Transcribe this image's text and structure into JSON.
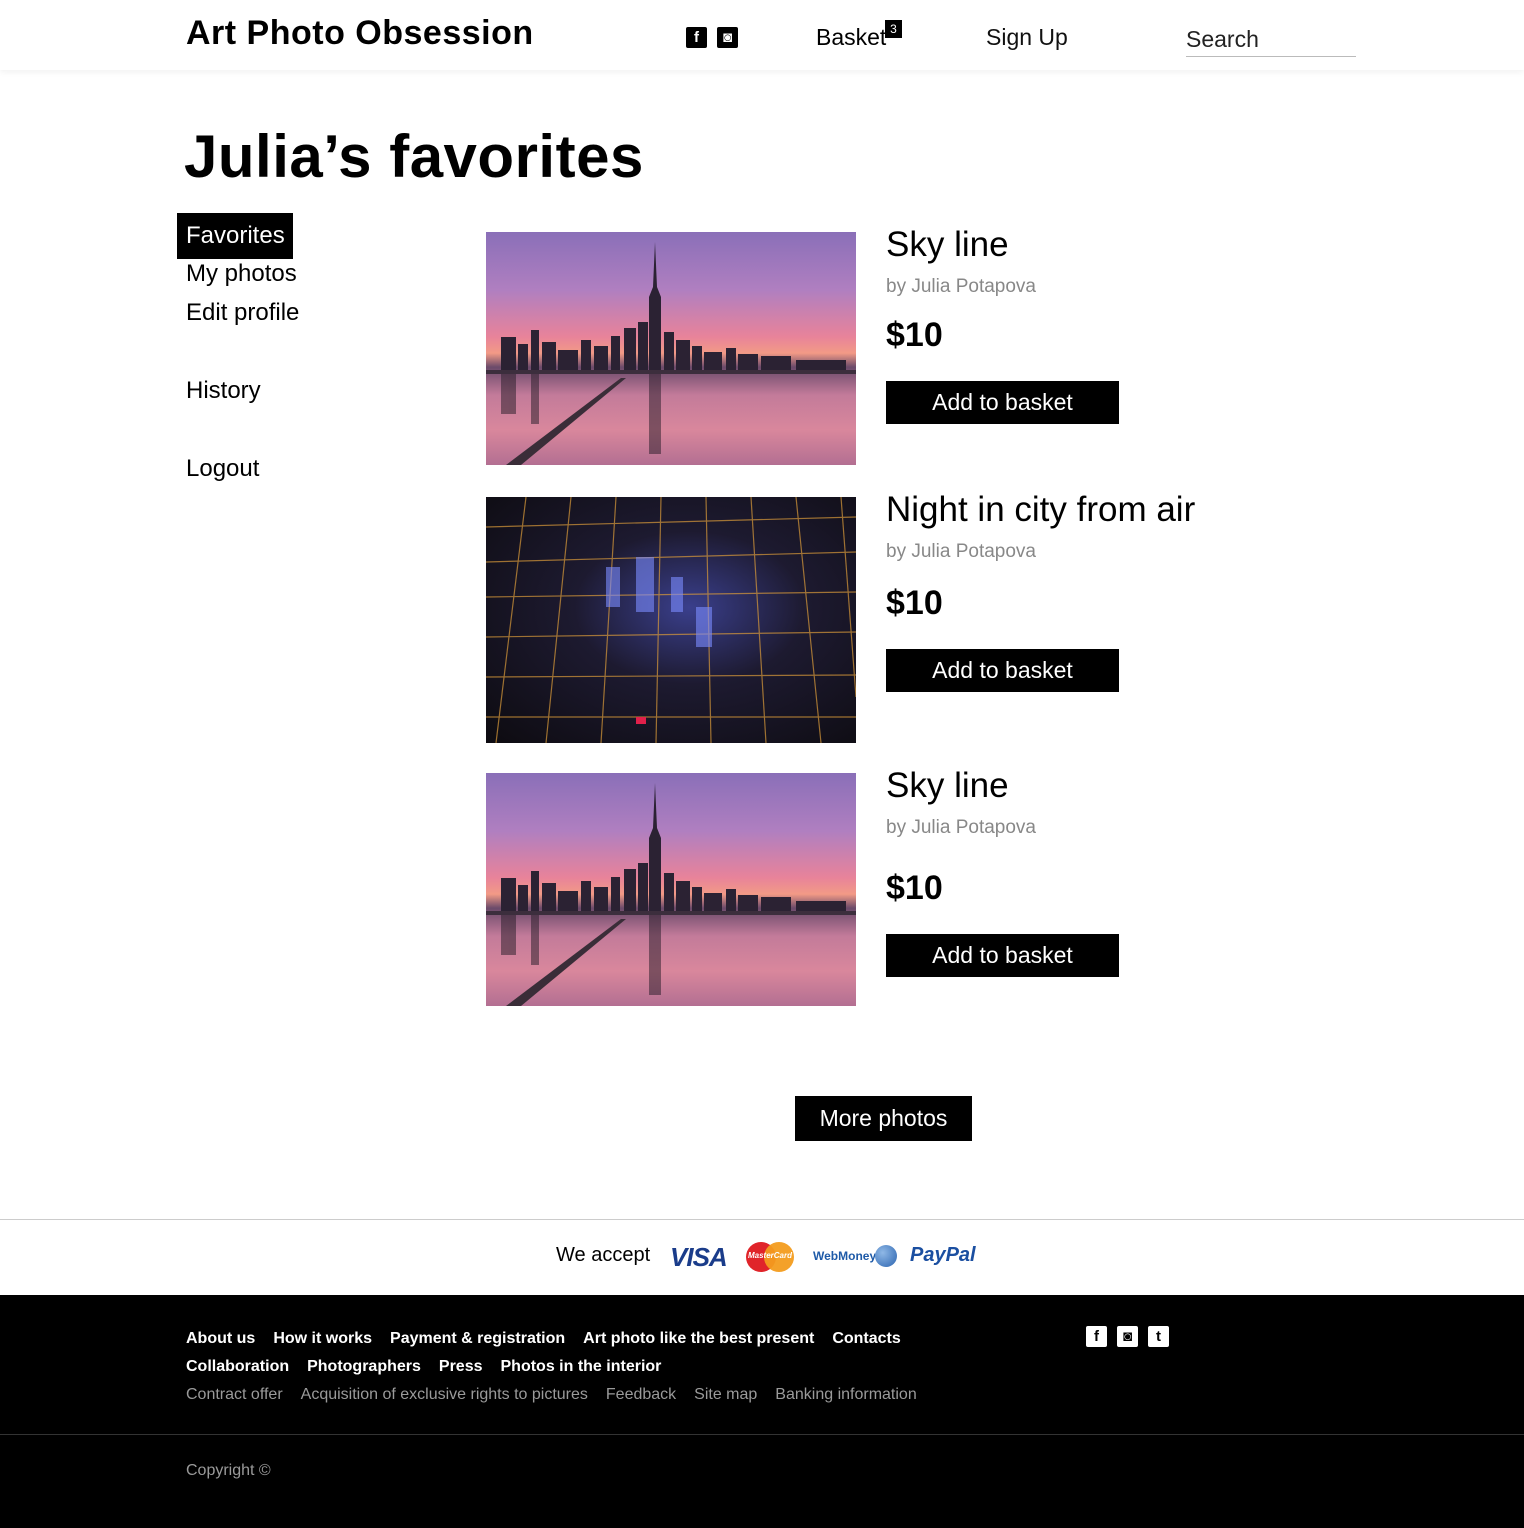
{
  "header": {
    "logo": "Art Photo Obsession",
    "social": [
      "facebook-icon",
      "instagram-icon"
    ],
    "basket_label": "Basket",
    "basket_count": "3",
    "signup_label": "Sign Up",
    "search_placeholder": "Search"
  },
  "page_title": "Julia’s favorites",
  "sidebar": {
    "items": [
      {
        "label": "Favorites",
        "active": true
      },
      {
        "label": "My photos"
      },
      {
        "label": "Edit profile"
      },
      {
        "label": "History"
      },
      {
        "label": "Logout"
      }
    ]
  },
  "photos": [
    {
      "title": "Sky line",
      "author": "by Julia Potapova",
      "price": "$10",
      "button": "Add to basket",
      "image": "skyline"
    },
    {
      "title": "Night in city from air",
      "author": "by Julia Potapova",
      "price": "$10",
      "button": "Add to basket",
      "image": "night-city"
    },
    {
      "title": "Sky line",
      "author": "by Julia Potapova",
      "price": "$10",
      "button": "Add to basket",
      "image": "skyline"
    }
  ],
  "more_button": "More photos",
  "payment": {
    "label": "We accept",
    "methods": [
      "VISA",
      "MasterCard",
      "WebMoney",
      "PayPal"
    ]
  },
  "footer": {
    "row1": [
      "About us",
      "How it works",
      "Payment & registration",
      "Art photo like the best present",
      "Contacts"
    ],
    "row2": [
      "Collaboration",
      "Photographers",
      "Press",
      "Photos in the interior"
    ],
    "row3": [
      "Contract offer",
      "Acquisition of exclusive rights to pictures",
      "Feedback",
      "Site map",
      "Banking information"
    ],
    "social": [
      "facebook-icon",
      "instagram-icon",
      "tumblr-icon"
    ],
    "copyright": "Copyright ©"
  }
}
